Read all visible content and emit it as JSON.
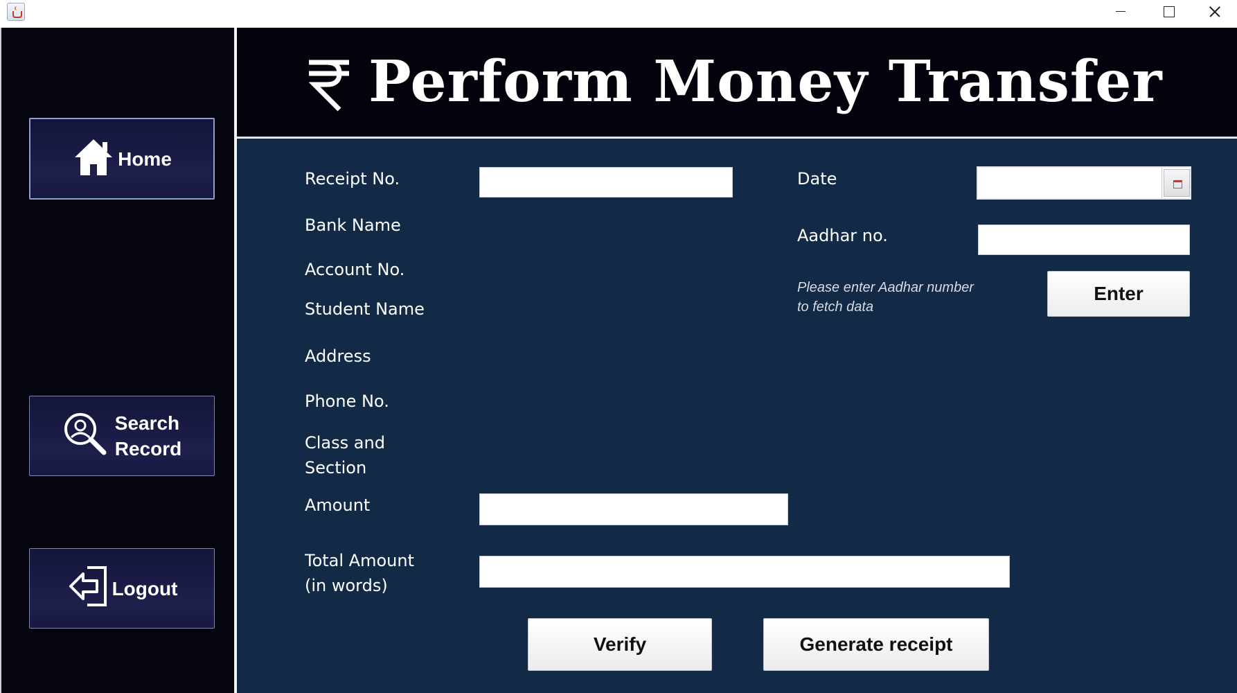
{
  "window": {
    "app_icon": "java-cup-icon",
    "controls": [
      "minimize-icon",
      "maximize-icon",
      "close-icon"
    ]
  },
  "sidebar": {
    "home": {
      "label": "Home",
      "icon": "house-icon"
    },
    "search": {
      "label_line1": "Search",
      "label_line2": "Record",
      "icon": "user-search-icon"
    },
    "logout": {
      "label": "Logout",
      "icon": "logout-arrow-icon"
    }
  },
  "header": {
    "title": "Perform Money Transfer",
    "icon": "rupee-icon"
  },
  "form": {
    "receipt_no": {
      "label": "Receipt No.",
      "value": ""
    },
    "date": {
      "label": "Date",
      "value": "",
      "picker_icon": "calendar-icon"
    },
    "bank_name": {
      "label": "Bank Name"
    },
    "aadhar_no": {
      "label": "Aadhar no.",
      "value": ""
    },
    "account_no": {
      "label": "Account No."
    },
    "student_name": {
      "label": "Student Name"
    },
    "hint_line1": "Please enter Aadhar number",
    "hint_line2": "to fetch data",
    "enter_button": "Enter",
    "address": {
      "label": "Address"
    },
    "phone_no": {
      "label": "Phone No."
    },
    "class_section": {
      "label_line1": "Class and",
      "label_line2": "Section"
    },
    "amount": {
      "label": "Amount",
      "value": ""
    },
    "total_amount": {
      "label_line1": "Total Amount",
      "label_line2": "(in words)",
      "value": ""
    },
    "verify_button": "Verify",
    "generate_button": "Generate receipt"
  },
  "colors": {
    "sidebar_bg": "#05050f",
    "header_bg": "#03030d",
    "content_bg": "#122a46",
    "nav_button_bg": "#1e1f4c"
  }
}
